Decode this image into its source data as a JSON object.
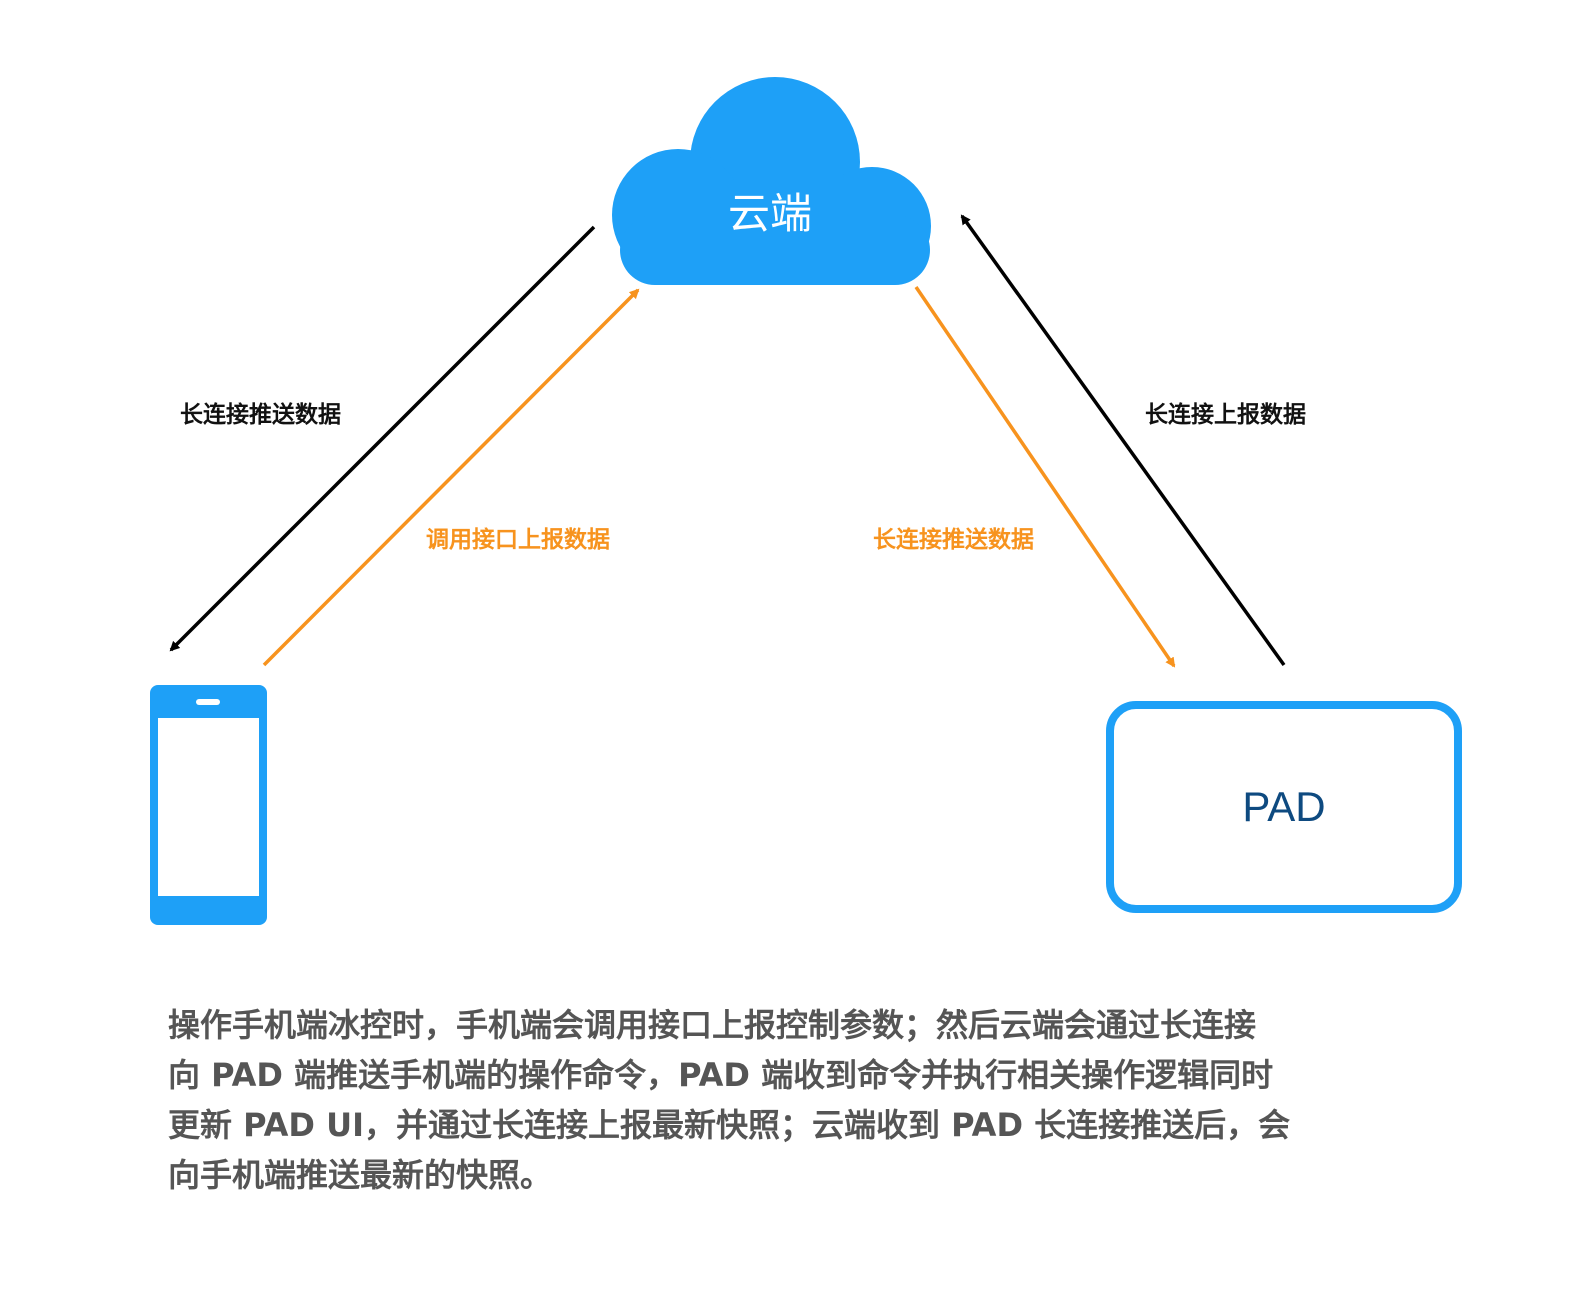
{
  "colors": {
    "cloud": "#1ea0f7",
    "phone": "#1ea0f7",
    "pad_border": "#1ea0f7",
    "pad_text": "#0e4a80",
    "black_arrow": "#000000",
    "orange_arrow": "#f7931e",
    "description_text": "#555555"
  },
  "nodes": {
    "cloud": {
      "label": "云端",
      "icon": "cloud-icon"
    },
    "phone": {
      "icon": "phone-icon"
    },
    "pad": {
      "label": "PAD"
    }
  },
  "edges": {
    "cloud_to_phone": {
      "label": "长连接推送数据"
    },
    "phone_to_cloud": {
      "label": "调用接口上报数据"
    },
    "cloud_to_pad": {
      "label": "长连接推送数据"
    },
    "pad_to_cloud": {
      "label": "长连接上报数据"
    }
  },
  "description": {
    "lines": [
      "操作手机端冰控时，手机端会调用接口上报控制参数；然后云端会通过长连接",
      "向 PAD 端推送手机端的操作命令，PAD 端收到命令并执行相关操作逻辑同时",
      "更新 PAD UI，并通过长连接上报最新快照；云端收到 PAD 长连接推送后，会",
      "向手机端推送最新的快照。"
    ]
  }
}
